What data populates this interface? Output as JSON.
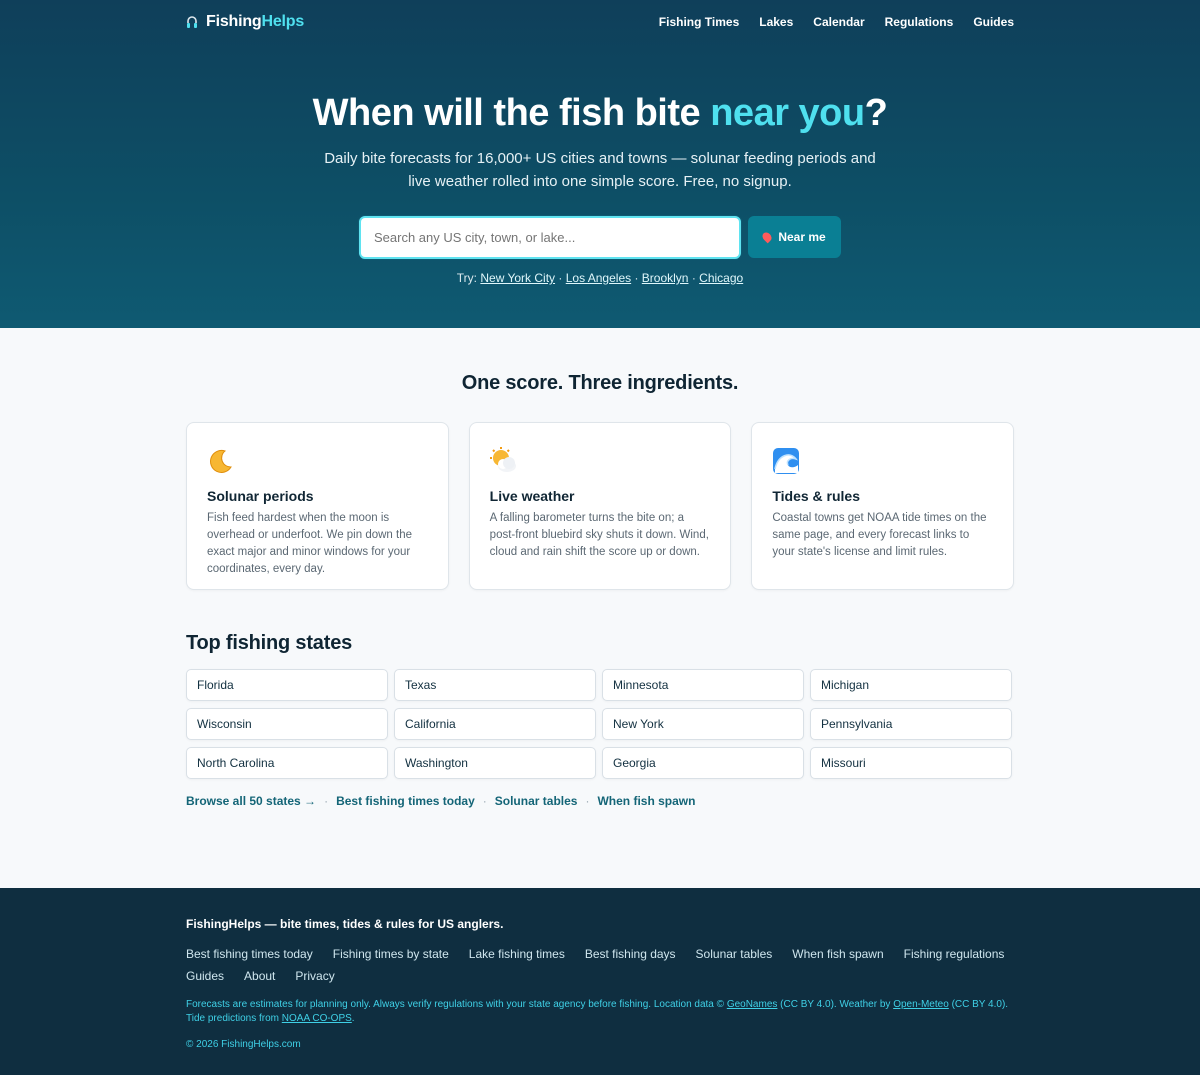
{
  "brand": {
    "part1": "Fishing",
    "part2": "Helps"
  },
  "nav": {
    "items": [
      "Fishing Times",
      "Lakes",
      "Calendar",
      "Regulations",
      "Guides"
    ]
  },
  "hero": {
    "title_main": "When will the fish bite ",
    "title_highlight": "near you",
    "title_end": "?",
    "subtitle": "Daily bite forecasts for 16,000+ US cities and towns — solunar feeding periods and live weather rolled into one simple score. Free, no signup.",
    "search_placeholder": "Search any US city, town, or lake...",
    "near_me": "Near me",
    "try_label": "Try:",
    "try_links": [
      "New York City",
      "Los Angeles",
      "Brooklyn",
      "Chicago"
    ]
  },
  "ingredients": {
    "title": "One score. Three ingredients.",
    "cards": [
      {
        "title": "Solunar periods",
        "text": "Fish feed hardest when the moon is overhead or underfoot. We pin down the exact major and minor windows for your coordinates, every day.",
        "icon": "crescent-moon-icon"
      },
      {
        "title": "Live weather",
        "text": "A falling barometer turns the bite on; a post-front bluebird sky shuts it down. Wind, cloud and rain shift the score up or down.",
        "icon": "sun-cloud-icon"
      },
      {
        "title": "Tides & rules",
        "text": "Coastal towns get NOAA tide times on the same page, and every forecast links to your state's license and limit rules.",
        "icon": "wave-icon"
      }
    ]
  },
  "states": {
    "title": "Top fishing states",
    "items": [
      "Florida",
      "Texas",
      "Minnesota",
      "Michigan",
      "Wisconsin",
      "California",
      "New York",
      "Pennsylvania",
      "North Carolina",
      "Washington",
      "Georgia",
      "Missouri"
    ],
    "links": [
      "Browse all 50 states →",
      "Best fishing times today",
      "Solunar tables",
      "When fish spawn"
    ]
  },
  "footer": {
    "title": "FishingHelps — bite times, tides & rules for US anglers.",
    "links": [
      "Best fishing times today",
      "Fishing times by state",
      "Lake fishing times",
      "Best fishing days",
      "Solunar tables",
      "When fish spawn",
      "Fishing regulations",
      "Guides",
      "About",
      "Privacy"
    ],
    "note_1": "Forecasts are estimates for planning only. Always verify regulations with your state agency before fishing. Location data ©",
    "note_geonames": "GeoNames",
    "note_2": "(CC BY 4.0). Weather by",
    "note_openmeteo": "Open-Meteo",
    "note_3": "(CC BY 4.0). Tide predictions from",
    "note_noaa": "NOAA CO-OPS",
    "note_4": ".",
    "copyright": "© 2026 FishingHelps.com"
  },
  "colors": {
    "accent": "#4fe0ef",
    "hero_bg": "#0f4f66",
    "footer_bg": "#0f2e40",
    "button": "#0a7f94"
  }
}
